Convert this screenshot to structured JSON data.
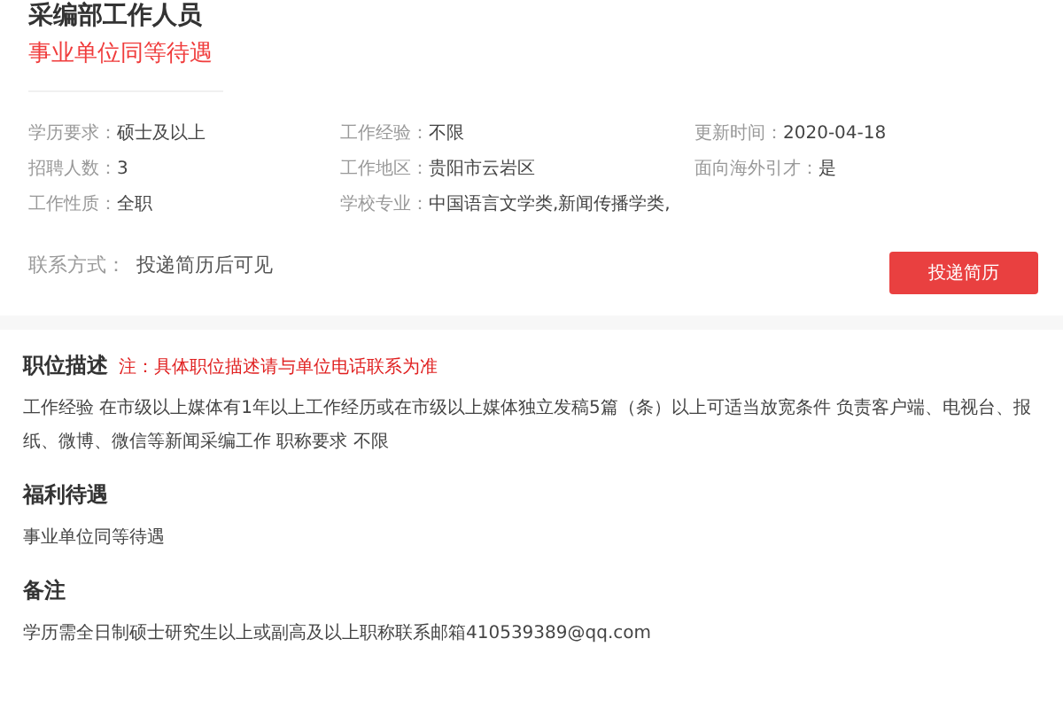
{
  "job": {
    "title": "采编部工作人员",
    "benefit_tag": "事业单位同等待遇"
  },
  "info": [
    {
      "label": "学历要求：",
      "value": "硕士及以上"
    },
    {
      "label": "工作经验：",
      "value": "不限"
    },
    {
      "label": "更新时间：",
      "value": "2020-04-18"
    },
    {
      "label": "招聘人数：",
      "value": "3"
    },
    {
      "label": "工作地区：",
      "value": "贵阳市云岩区"
    },
    {
      "label": "面向海外引才：",
      "value": "是"
    },
    {
      "label": "工作性质：",
      "value": "全职"
    },
    {
      "label": "学校专业：",
      "value": "中国语言文学类,新闻传播学类,"
    }
  ],
  "contact": {
    "label": "联系方式：",
    "value": "投递简历后可见"
  },
  "apply_button": "投递简历",
  "sections": [
    {
      "title": "职位描述",
      "note": "注：具体职位描述请与单位电话联系为准",
      "text": "工作经验 在市级以上媒体有1年以上工作经历或在市级以上媒体独立发稿5篇（条）以上可适当放宽条件 负责客户端、电视台、报纸、微博、微信等新闻采编工作 职称要求 不限"
    },
    {
      "title": "福利待遇",
      "text": "事业单位同等待遇"
    },
    {
      "title": "备注",
      "text": "学历需全日制硕士研究生以上或副高及以上职称联系邮箱410539389@qq.com"
    }
  ]
}
